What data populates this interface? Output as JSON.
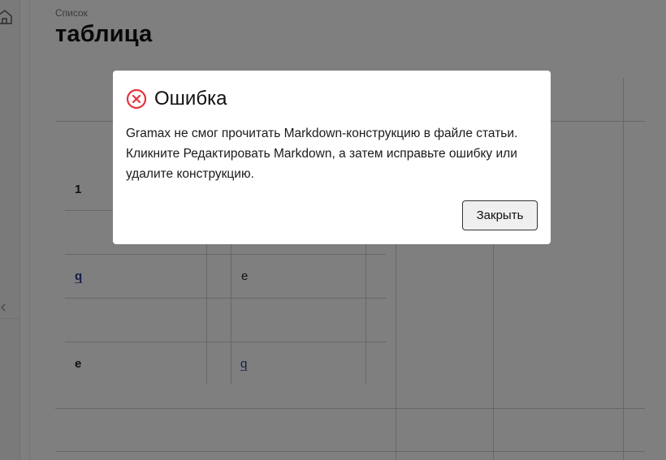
{
  "breadcrumb": "Список",
  "page_title": "таблица",
  "table": {
    "cells": {
      "row1_col1": "1",
      "row3_col1": "q",
      "row3_col2": "e",
      "row5_col1": "e",
      "row5_col2": "q"
    }
  },
  "icons": {
    "sidebar_home": "home-icon",
    "sidebar_collapse": "chevron-left-icon",
    "modal_error": "error-circle-x-icon"
  },
  "modal": {
    "title": "Ошибка",
    "message_line1": "Gramax не смог прочитать Markdown-конструкцию в файле статьи.",
    "message_line2": "Кликните Редактировать Markdown, а затем исправьте ошибку или удалите конструкцию.",
    "close_label": "Закрыть"
  },
  "colors": {
    "error_red": "#e5333d",
    "link_blue": "#2a3c8f",
    "overlay": "rgba(0,0,0,0.5)"
  }
}
